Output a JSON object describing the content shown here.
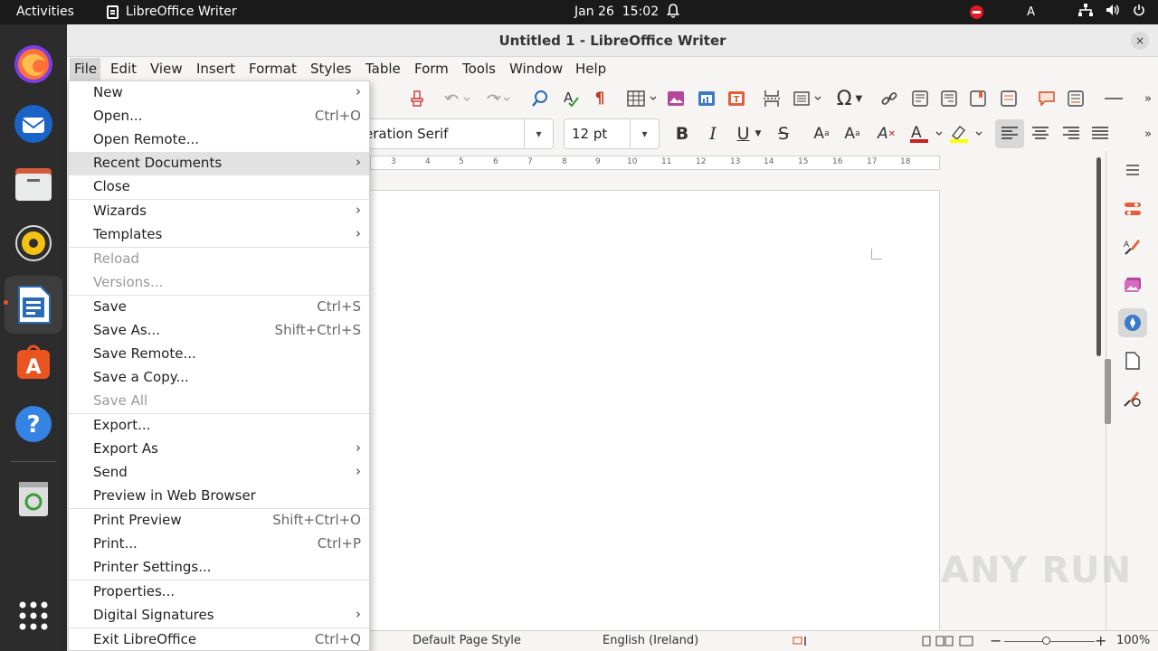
{
  "topbar": {
    "activities": "Activities",
    "app_name": "LibreOffice Writer",
    "date": "Jan 26",
    "time": "15:02",
    "input_indicator": "A"
  },
  "window": {
    "title": "Untitled 1 - LibreOffice Writer",
    "close": "×"
  },
  "menubar": {
    "items": [
      "File",
      "Edit",
      "View",
      "Insert",
      "Format",
      "Styles",
      "Table",
      "Form",
      "Tools",
      "Window",
      "Help"
    ]
  },
  "formatting": {
    "font_name": "eration Serif",
    "font_size": "12 pt"
  },
  "ruler": {
    "ticks": [
      "3",
      "4",
      "5",
      "6",
      "7",
      "8",
      "9",
      "10",
      "11",
      "12",
      "13",
      "14",
      "15",
      "16",
      "17",
      "18"
    ]
  },
  "statusbar": {
    "page_style": "Default Page Style",
    "language": "English (Ireland)",
    "zoom": "100%"
  },
  "file_menu": {
    "items": [
      {
        "label": "New",
        "submenu": true
      },
      {
        "label": "Open...",
        "shortcut": "Ctrl+O"
      },
      {
        "label": "Open Remote..."
      },
      {
        "label": "Recent Documents",
        "submenu": true,
        "highlighted": true
      },
      {
        "label": "Close"
      },
      {
        "label": "Wizards",
        "submenu": true
      },
      {
        "label": "Templates",
        "submenu": true
      },
      {
        "label": "Reload",
        "disabled": true
      },
      {
        "label": "Versions...",
        "disabled": true
      },
      {
        "label": "Save",
        "shortcut": "Ctrl+S"
      },
      {
        "label": "Save As...",
        "shortcut": "Shift+Ctrl+S"
      },
      {
        "label": "Save Remote..."
      },
      {
        "label": "Save a Copy..."
      },
      {
        "label": "Save All",
        "disabled": true
      },
      {
        "label": "Export..."
      },
      {
        "label": "Export As",
        "submenu": true
      },
      {
        "label": "Send",
        "submenu": true
      },
      {
        "label": "Preview in Web Browser"
      },
      {
        "label": "Print Preview",
        "shortcut": "Shift+Ctrl+O"
      },
      {
        "label": "Print...",
        "shortcut": "Ctrl+P"
      },
      {
        "label": "Printer Settings..."
      },
      {
        "label": "Properties..."
      },
      {
        "label": "Digital Signatures",
        "submenu": true
      },
      {
        "label": "Exit LibreOffice",
        "shortcut": "Ctrl+Q"
      }
    ]
  },
  "watermark": "ANY RUN",
  "colors": {
    "accent_orange": "#e95420",
    "dnd_red": "#e01b24",
    "font_color_red": "#c9211e",
    "highlight_yellow": "#ffff00"
  }
}
